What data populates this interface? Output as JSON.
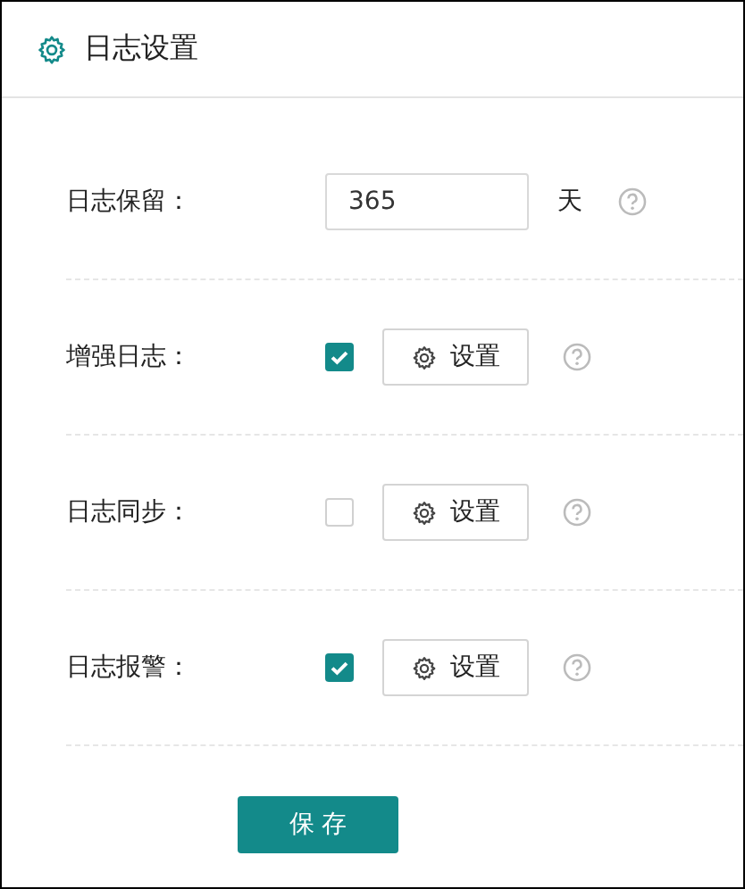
{
  "title": "日志设置",
  "rows": [
    {
      "kind": "number",
      "label": "日志保留：",
      "value": "365",
      "unit": "天"
    },
    {
      "kind": "toggle",
      "label": "增强日志：",
      "checked": true,
      "button": "设置"
    },
    {
      "kind": "toggle",
      "label": "日志同步：",
      "checked": false,
      "button": "设置"
    },
    {
      "kind": "toggle",
      "label": "日志报警：",
      "checked": true,
      "button": "设置"
    }
  ],
  "save_button": "保 存"
}
